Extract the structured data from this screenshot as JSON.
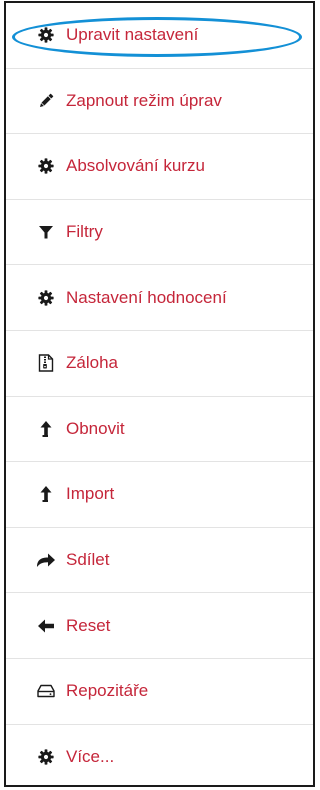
{
  "menu": {
    "items": [
      {
        "label": "Upravit nastavení",
        "icon": "gear-icon",
        "highlighted": true
      },
      {
        "label": "Zapnout režim úprav",
        "icon": "pencil-icon",
        "highlighted": false
      },
      {
        "label": "Absolvování kurzu",
        "icon": "gear-icon",
        "highlighted": false
      },
      {
        "label": "Filtry",
        "icon": "filter-icon",
        "highlighted": false
      },
      {
        "label": "Nastavení hodnocení",
        "icon": "gear-icon",
        "highlighted": false
      },
      {
        "label": "Záloha",
        "icon": "archive-file-icon",
        "highlighted": false
      },
      {
        "label": "Obnovit",
        "icon": "upload-arrow-icon",
        "highlighted": false
      },
      {
        "label": "Import",
        "icon": "upload-arrow-icon",
        "highlighted": false
      },
      {
        "label": "Sdílet",
        "icon": "share-arrow-icon",
        "highlighted": false
      },
      {
        "label": "Reset",
        "icon": "arrow-left-icon",
        "highlighted": false
      },
      {
        "label": "Repozitáře",
        "icon": "hard-drive-icon",
        "highlighted": false
      },
      {
        "label": "Více...",
        "icon": "gear-icon",
        "highlighted": false
      }
    ]
  },
  "colors": {
    "link": "#c5263a",
    "icon": "#1a1a1a",
    "highlight": "#1390d6",
    "border": "#1a1a1a",
    "divider": "#e3e3e3"
  }
}
